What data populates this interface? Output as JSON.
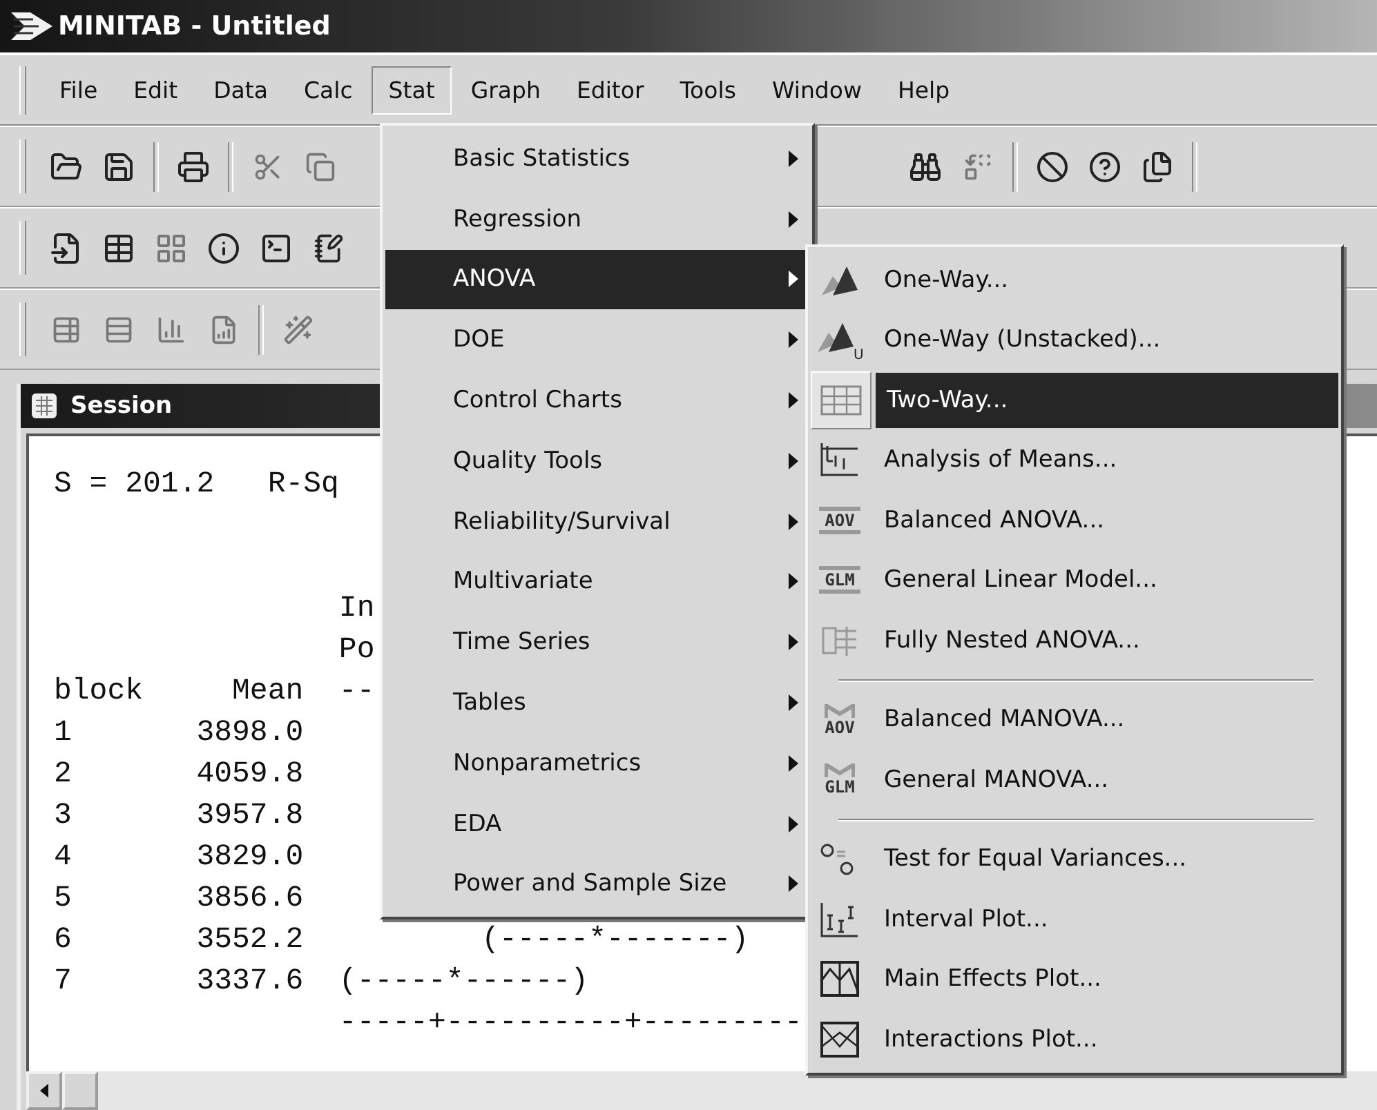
{
  "window": {
    "title": "MINITAB - Untitled"
  },
  "menubar": [
    {
      "label": "File",
      "selected": false
    },
    {
      "label": "Edit",
      "selected": false
    },
    {
      "label": "Data",
      "selected": false
    },
    {
      "label": "Calc",
      "selected": false
    },
    {
      "label": "Stat",
      "selected": true
    },
    {
      "label": "Graph",
      "selected": false
    },
    {
      "label": "Editor",
      "selected": false
    },
    {
      "label": "Tools",
      "selected": false
    },
    {
      "label": "Window",
      "selected": false
    },
    {
      "label": "Help",
      "selected": false
    }
  ],
  "stat_menu": {
    "items": [
      {
        "label": "Basic Statistics",
        "selected": false
      },
      {
        "label": "Regression",
        "selected": false
      },
      {
        "label": "ANOVA",
        "selected": true
      },
      {
        "label": "DOE",
        "selected": false
      },
      {
        "label": "Control Charts",
        "selected": false
      },
      {
        "label": "Quality Tools",
        "selected": false
      },
      {
        "label": "Reliability/Survival",
        "selected": false
      },
      {
        "label": "Multivariate",
        "selected": false
      },
      {
        "label": "Time Series",
        "selected": false
      },
      {
        "label": "Tables",
        "selected": false
      },
      {
        "label": "Nonparametrics",
        "selected": false
      },
      {
        "label": "EDA",
        "selected": false
      },
      {
        "label": "Power and Sample Size",
        "selected": false
      }
    ]
  },
  "anova_submenu": {
    "items": [
      {
        "kind": "item",
        "label": "One-Way...",
        "selected": false
      },
      {
        "kind": "item",
        "icon_label": "U",
        "label": "One-Way (Unstacked)...",
        "selected": false
      },
      {
        "kind": "item",
        "label": "Two-Way...",
        "selected": true
      },
      {
        "kind": "item",
        "label": "Analysis of Means...",
        "selected": false
      },
      {
        "kind": "item",
        "icon_label": "AOV",
        "label": "Balanced ANOVA...",
        "selected": false
      },
      {
        "kind": "item",
        "icon_label": "GLM",
        "label": "General Linear Model...",
        "selected": false
      },
      {
        "kind": "item",
        "label": "Fully Nested ANOVA...",
        "selected": false
      },
      {
        "kind": "separator"
      },
      {
        "kind": "item",
        "icon_label": "AOV",
        "label": "Balanced MANOVA...",
        "selected": false
      },
      {
        "kind": "item",
        "icon_label": "GLM",
        "label": "General MANOVA...",
        "selected": false
      },
      {
        "kind": "separator"
      },
      {
        "kind": "item",
        "label": "Test for Equal Variances...",
        "selected": false
      },
      {
        "kind": "item",
        "label": "Interval Plot...",
        "selected": false
      },
      {
        "kind": "item",
        "label": "Main Effects Plot...",
        "selected": false
      },
      {
        "kind": "item",
        "label": "Interactions Plot...",
        "selected": false
      }
    ]
  },
  "session": {
    "title": "Session",
    "blocks": [
      {
        "lines": [
          "S = 201.2   R-Sq"
        ]
      },
      {
        "lines": [
          "                In",
          "                Po",
          "block     Mean  --",
          "1       3898.0",
          "2       4059.8",
          "3       3957.8",
          "4       3829.0",
          "5       3856.6",
          "6       3552.2          (-----*-------)",
          "7       3337.6  (-----*------)",
          "                -----+----------+---------"
        ]
      }
    ]
  }
}
